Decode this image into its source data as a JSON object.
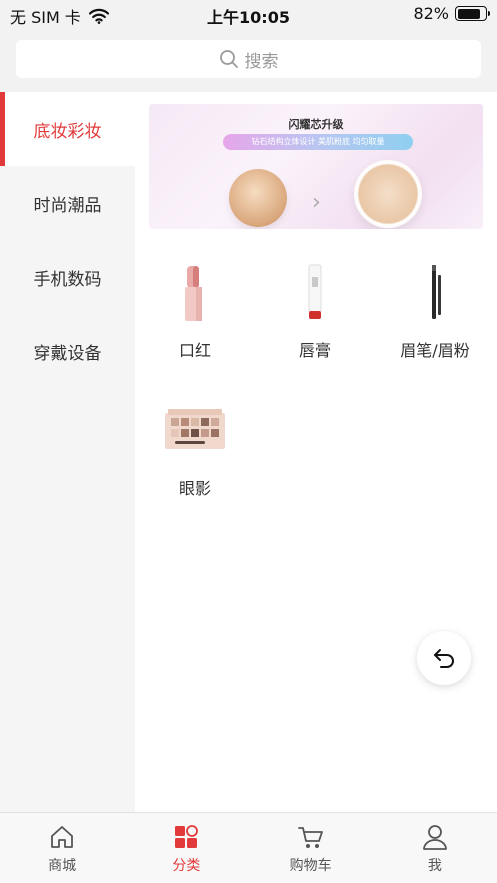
{
  "status_bar": {
    "carrier": "无 SIM 卡",
    "time": "上午10:05",
    "battery": "82%",
    "battery_level": 0.82,
    "wifi_icon": "wifi-icon"
  },
  "search": {
    "placeholder": "搜索",
    "icon": "search-icon"
  },
  "sidebar": {
    "items": [
      {
        "label": "底妆彩妆",
        "active": true
      },
      {
        "label": "时尚潮品",
        "active": false
      },
      {
        "label": "手机数码",
        "active": false
      },
      {
        "label": "穿戴设备",
        "active": false
      }
    ]
  },
  "banner": {
    "title": "闪耀芯升级",
    "subtitle": "钻石结构立体设计  美肌粉底  均匀取量"
  },
  "categories": [
    {
      "label": "口红",
      "icon": "lipstick-icon"
    },
    {
      "label": "唇膏",
      "icon": "lip-balm-icon"
    },
    {
      "label": "眉笔/眉粉",
      "icon": "eyebrow-pencil-icon"
    },
    {
      "label": "眼影",
      "icon": "eyeshadow-palette-icon"
    }
  ],
  "tab_bar": {
    "tabs": [
      {
        "label": "商城",
        "icon": "home-icon",
        "active": false
      },
      {
        "label": "分类",
        "icon": "category-icon",
        "active": true
      },
      {
        "label": "购物车",
        "icon": "cart-icon",
        "active": false
      },
      {
        "label": "我",
        "icon": "user-icon",
        "active": false
      }
    ]
  },
  "colors": {
    "accent": "#e23a3a",
    "sidebar_bg": "#f5f5f5",
    "header_bg": "#f2f2f2"
  }
}
